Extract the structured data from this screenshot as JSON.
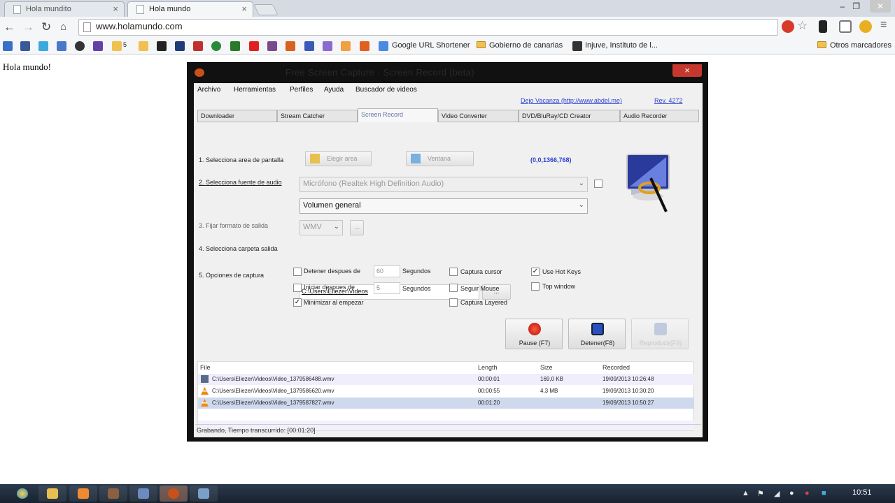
{
  "browser": {
    "tabs": [
      {
        "label": "Hola mundito",
        "close": "×"
      },
      {
        "label": "Hola mundo",
        "close": "×"
      }
    ],
    "url": "www.holamundo.com",
    "bookmarks": {
      "b1": "Google URL Shortener",
      "b2": "Gobierno de canarias",
      "b3": "Injuve, Instituto de l...",
      "other": "Otros marcadores",
      "count_badge": "5"
    },
    "page_text": "Hola mundo!"
  },
  "app": {
    "title": "Free Screen Capture · Screen Record (beta)",
    "close": "×",
    "menu": [
      "Archivo",
      "Herramientas",
      "Perfiles",
      "Ayuda",
      "Buscador de videos"
    ],
    "donate": "Dejo Vacanza (http://www.abdel.me)",
    "rev": "Rev. 4272",
    "tabs": [
      "Downloader",
      "Stream Catcher",
      "Screen Record",
      "Video Converter",
      "DVD/BluRay/CD Creator",
      "Audio Recorder"
    ],
    "step1": "1. Selecciona area de pantalla",
    "btn_area": "Elegir area",
    "btn_window": "Ventana",
    "coords": "(0,0,1366,768)",
    "step2": "2. Selecciona fuente de audio",
    "audio_source": "Micrófono (Realtek High Definition Audio)",
    "audio_volume": "Volumen general",
    "step3": "3. Fijar formato de salida",
    "format": "WMV",
    "browse_fmt": "...",
    "step4": "4. Selecciona carpeta salida",
    "folder": "C:\\Users\\Eliezer\\Videos",
    "browse": "...",
    "step5": "5. Opciones de captura",
    "opt_stop": "Detener despues de",
    "opt_stop_val": "60",
    "opt_start": "Iniciar despues de",
    "opt_start_val": "5",
    "seg": "Segundos",
    "opt_min": "Minimizar al empezar",
    "opt_cursor": "Captura cursor",
    "opt_mouse": "Seguir Mouse",
    "opt_layered": "Captura Layered",
    "opt_hotkeys": "Use Hot Keys",
    "opt_top": "Top window",
    "check_mark": "✓",
    "btn_pause": "Pause (F7)",
    "btn_stop": "Detener(F8)",
    "btn_play": "Reproducir(F9)",
    "list_headers": {
      "file": "File",
      "length": "Length",
      "size": "Size",
      "recorded": "Recorded"
    },
    "rows": [
      {
        "file": "C:\\Users\\Eliezer\\Videos\\Video_1379586488.wmv",
        "length": "00:00:01",
        "size": "169,0 KB",
        "recorded": "19/09/2013 10:26:48"
      },
      {
        "file": "C:\\Users\\Eliezer\\Videos\\Video_1379586620.wmv",
        "length": "00:00:55",
        "size": "4,3 MB",
        "recorded": "19/09/2013 10:30:20"
      },
      {
        "file": "C:\\Users\\Eliezer\\Videos\\Video_1379587827.wmv",
        "length": "00:01:20",
        "size": "",
        "recorded": "19/09/2013 10:50:27"
      }
    ],
    "status": "Grabando, Tiempo transcurrido: [00:01:20]"
  },
  "taskbar": {
    "clock": "10:51"
  }
}
